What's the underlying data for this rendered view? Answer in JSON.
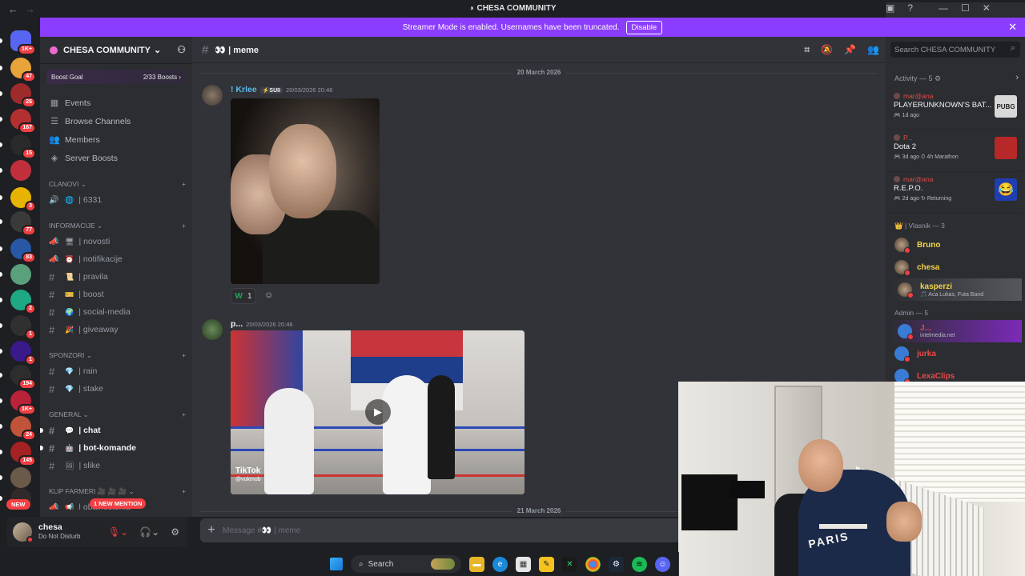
{
  "titlebar": {
    "title": "CHESA COMMUNITY",
    "back": "←",
    "forward": "→"
  },
  "servers": [
    {
      "icon": "discord-home-icon",
      "badge": "1K+",
      "color": "#5865f2"
    },
    {
      "icon": "server-icon",
      "badge": "47",
      "color": "#e8a33a"
    },
    {
      "icon": "server-icon",
      "badge": "26",
      "color": "#9e2b2b"
    },
    {
      "icon": "server-icon",
      "badge": "167",
      "color": "#b23030"
    },
    {
      "icon": "server-icon",
      "badge": "15",
      "color": "#2a2a2a"
    },
    {
      "icon": "server-icon",
      "badge": "",
      "color": "#c0303c"
    },
    {
      "icon": "server-icon",
      "badge": "3",
      "color": "#e6b400"
    },
    {
      "icon": "server-icon",
      "badge": "77",
      "color": "#3a3a3a"
    },
    {
      "icon": "server-icon",
      "badge": "83",
      "color": "#2757a5"
    },
    {
      "icon": "server-icon",
      "badge": "",
      "color": "#5aa07a"
    },
    {
      "icon": "server-icon",
      "badge": "2",
      "color": "#1ea884"
    },
    {
      "icon": "server-icon",
      "badge": "1",
      "color": "#303030"
    },
    {
      "icon": "server-icon",
      "badge": "1",
      "color": "#3a1a8a"
    },
    {
      "icon": "server-icon",
      "badge": "194",
      "color": "#2d2d2d"
    },
    {
      "icon": "server-icon",
      "badge": "1K+",
      "color": "#b8233a"
    },
    {
      "icon": "server-icon",
      "badge": "24",
      "color": "#c0533a"
    },
    {
      "icon": "server-icon",
      "badge": "145",
      "color": "#a52222"
    },
    {
      "icon": "server-icon",
      "badge": "",
      "color": "#6a5a4a"
    },
    {
      "icon": "server-icon",
      "badge": "",
      "color": "#302a2a"
    }
  ],
  "new_label": "NEW",
  "banner": {
    "text": "Streamer Mode is enabled. Usernames have been truncated.",
    "button": "Disable"
  },
  "guild": {
    "name": "CHESA COMMUNITY",
    "boost_label": "Boost Goal",
    "boost_count": "2/33 Boosts"
  },
  "nav": [
    {
      "icon": "calendar-icon",
      "label": "Events"
    },
    {
      "icon": "browse-icon",
      "label": "Browse Channels"
    },
    {
      "icon": "members-icon",
      "label": "Members"
    },
    {
      "icon": "boost-icon",
      "label": "Server Boosts"
    }
  ],
  "categories": {
    "clanovi": "CLANOVI",
    "informacije": "INFORMACIJE",
    "sponzori": "SPONZORI",
    "general": "GENERAL",
    "klip": "KLIP FARMERI 🎥 🎥 🎥"
  },
  "channels": {
    "clanovi": [
      {
        "emoji": "🌐",
        "label": "| 6331"
      }
    ],
    "informacije": [
      {
        "emoji": "🖥",
        "label": "| novosti"
      },
      {
        "emoji": "⏰",
        "label": "| notifikacije"
      },
      {
        "emoji": "📜",
        "label": "| pravila"
      },
      {
        "emoji": "🎫",
        "label": "| boost"
      },
      {
        "emoji": "🌍",
        "label": "| social-media"
      },
      {
        "emoji": "🎉",
        "label": "| giveaway"
      }
    ],
    "sponzori": [
      {
        "emoji": "💎",
        "label": "| rain"
      },
      {
        "emoji": "💎",
        "label": "| stake"
      }
    ],
    "general": [
      {
        "emoji": "💬",
        "label": "| chat"
      },
      {
        "emoji": "🤖",
        "label": "| bot-komande"
      },
      {
        "emoji": "🖼",
        "label": "| slike"
      }
    ],
    "klip": [
      {
        "emoji": "📢",
        "label": "| obavjestenja"
      }
    ]
  },
  "mention_pill": "1 NEW MENTION",
  "user": {
    "name": "chesa",
    "status": "Do Not Disturb"
  },
  "channel": {
    "name": "👀 | meme",
    "placeholder": "Message #👀 | meme"
  },
  "search_placeholder": "Search CHESA COMMUNITY",
  "messages": {
    "date1": "20 March 2026",
    "date2": "21 March 2026",
    "m1": {
      "author": "! Krlee",
      "tag": "⚡SUII",
      "time": "20/03/2026 20:46",
      "reaction_emoji": "W",
      "reaction_count": "1"
    },
    "m2": {
      "author": "p...",
      "time": "20/03/2026 20:46",
      "tiktok": "TikTok",
      "tiktok_handle": "@vukmob"
    }
  },
  "activity": {
    "header": "Activity — 5",
    "items": [
      {
        "who": "mar@ana",
        "game": "PLAYERUNKNOWN'S BAT...",
        "meta": "🎮 1d ago",
        "icon_text": "PUBG",
        "icon_color": "#d8d8d8"
      },
      {
        "who": "P...",
        "game": "Dota 2",
        "meta": "🎮 3d ago  ⏱ 4h Marathon",
        "icon_text": "",
        "icon_color": "#b72828"
      },
      {
        "who": "mar@ana",
        "game": "R.E.P.O.",
        "meta": "🎮 2d ago  ↻ Returning",
        "icon_text": "😂",
        "icon_color": "#1f3fb0"
      }
    ]
  },
  "groups": {
    "vlasnik": "👑 | Vlasnik — 3",
    "admin": "Admin — 5"
  },
  "members": {
    "vlasnik": [
      {
        "name": "Bruno",
        "sub": "",
        "color": "#f0d34a"
      },
      {
        "name": "chesa",
        "sub": "",
        "color": "#f0d34a"
      },
      {
        "name": "kasperzi",
        "sub": "🎵 Aca Lukas, Futa Band",
        "color": "#f0d34a"
      }
    ],
    "admin": [
      {
        "name": "J...",
        "sub": "intelmedia.net",
        "color": "#e64a4a"
      },
      {
        "name": "jurka",
        "sub": "",
        "color": "#e64a4a"
      },
      {
        "name": "LexaClips",
        "sub": "",
        "color": "#e64a4a"
      }
    ]
  },
  "webcam": {
    "shirt_text": "PARIS"
  },
  "taskbar": {
    "search": "Search"
  }
}
